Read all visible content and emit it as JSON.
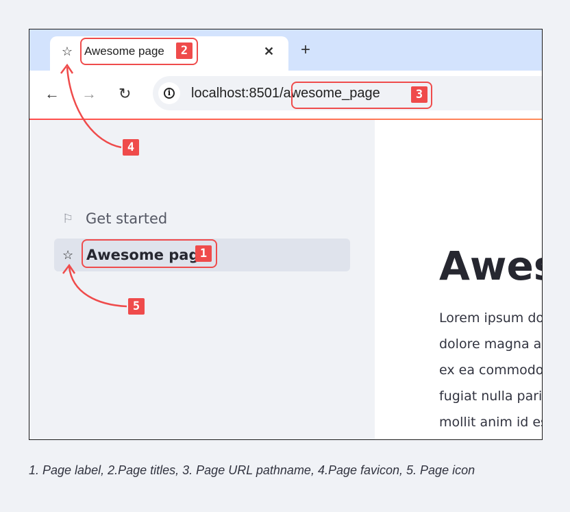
{
  "browser": {
    "tab": {
      "favicon": "star-icon",
      "title": "Awesome page",
      "close_glyph": "✕"
    },
    "new_tab_glyph": "+",
    "nav": {
      "back_glyph": "←",
      "forward_glyph": "→",
      "reload_glyph": "↻"
    },
    "address_bar": {
      "host": "localhost:8501",
      "separator": "/",
      "path": "awesome_page",
      "info_icon": "info-icon"
    }
  },
  "sidebar": {
    "items": [
      {
        "icon": "rocket-icon",
        "glyph": "⚐",
        "label": "Get started",
        "active": false
      },
      {
        "icon": "star-icon",
        "glyph": "☆",
        "label": "Awesome page",
        "active": true
      }
    ]
  },
  "main": {
    "heading": "Awesome page",
    "body_lines": [
      "Lorem ipsum dolor sit amet",
      "dolore magna aliqua",
      "ex ea commodo consequat",
      "fugiat nulla pariatur",
      "mollit anim id est laborum"
    ]
  },
  "annotations": {
    "badges": [
      "1",
      "2",
      "3",
      "4",
      "5"
    ],
    "color": "#ef4b4b"
  },
  "caption": "1. Page label, 2.Page titles, 3. Page URL pathname, 4.Page favicon, 5. Page icon",
  "colors": {
    "tabstrip": "#d3e3fd",
    "accent": "#ff4b4b",
    "sidebar_bg": "#f0f2f6",
    "active_item": "#dfe3ec"
  }
}
